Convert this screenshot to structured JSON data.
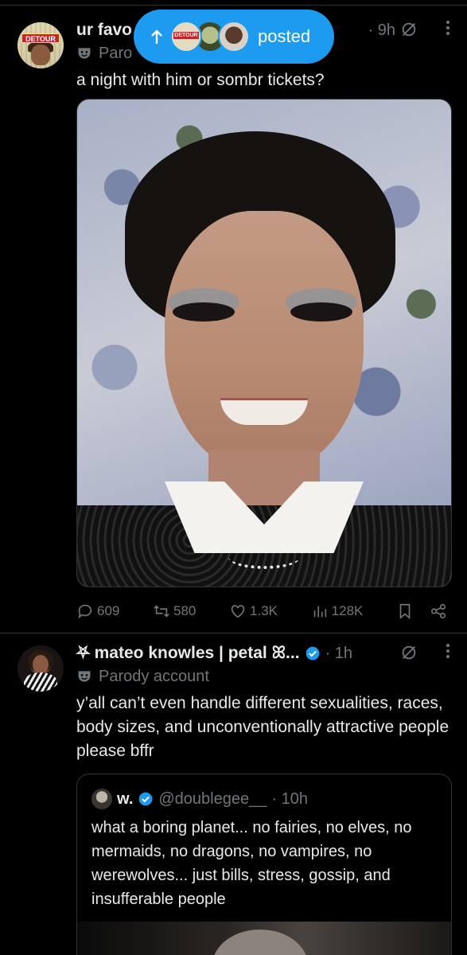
{
  "post1": {
    "author_name": "ur favo",
    "time": "· 9h",
    "sub_label": "Paro",
    "text": "a night with him or sombr tickets?",
    "avatar_logo": "DETOUR",
    "actions": {
      "replies": "609",
      "reposts": "580",
      "likes": "1.3K",
      "views": "128K"
    }
  },
  "new_posts_pill": {
    "label": "posted",
    "mini_logo": "DETOUR"
  },
  "post2": {
    "author_name": "⛧ mateo knowles | petal ꕤ...",
    "time": "· 1h",
    "sub_label": "Parody account",
    "text": "y’all can’t even handle different sexualities, races, body sizes, and unconventionally attractive people please bffr",
    "quote": {
      "author_name": "w.",
      "handle": "@doublegee__",
      "time": "· 10h",
      "text": "what a boring planet... no fairies, no elves, no mermaids, no dragons, no vampires, no werewolves... just bills, stress, gossip, and insufferable people"
    }
  },
  "colors": {
    "background": "#000000",
    "accent": "#1d9bf0",
    "muted": "#71767b",
    "text": "#e7e9ea",
    "border": "#2f3336"
  },
  "icons": [
    "arrow-up-icon",
    "grok-icon",
    "more-icon",
    "parody-mask-icon",
    "reply-icon",
    "repost-icon",
    "like-icon",
    "views-icon",
    "bookmark-icon",
    "share-icon",
    "verified-icon"
  ]
}
